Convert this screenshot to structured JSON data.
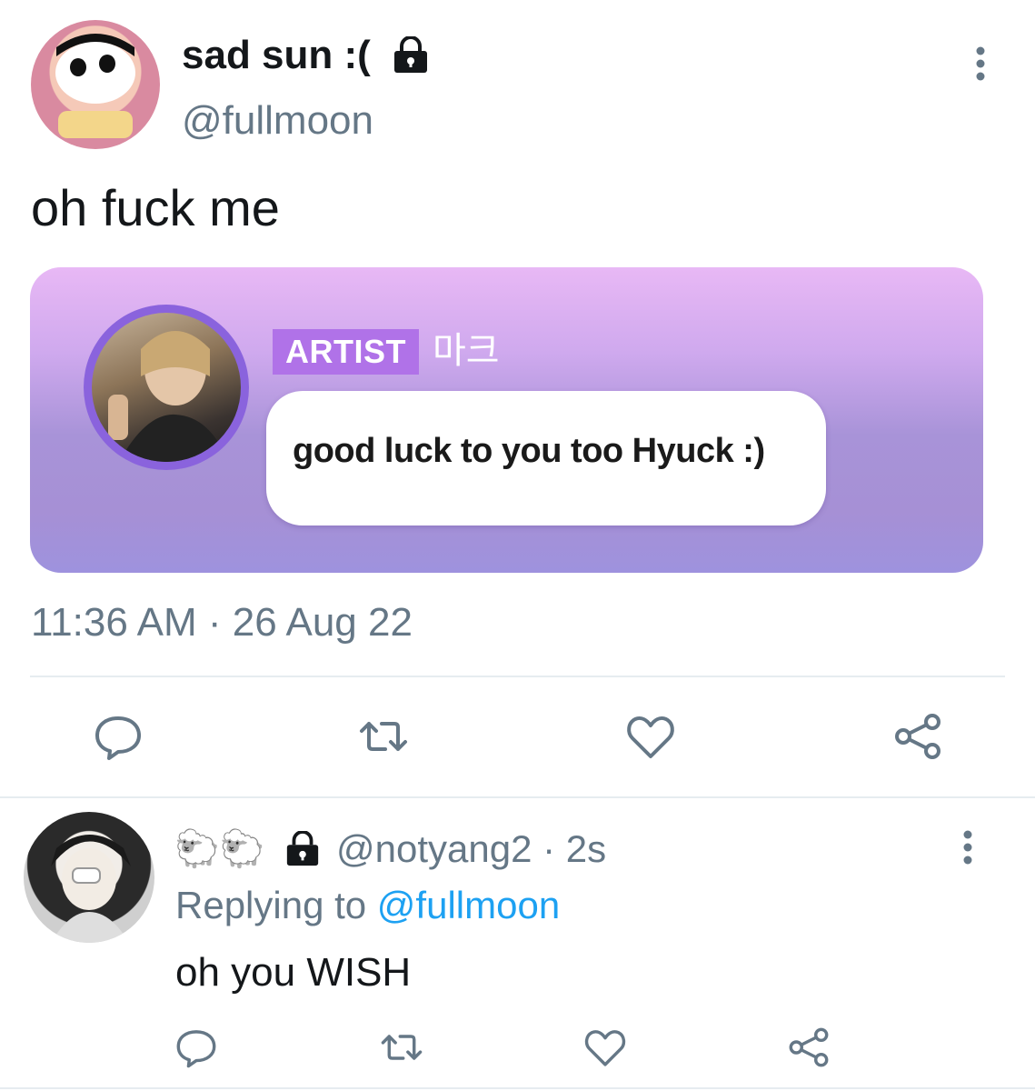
{
  "tweet": {
    "display_name": "sad sun :(",
    "handle": "@fullmoon",
    "text": "oh fuck me",
    "timestamp": "11:36 AM · 26 Aug 22"
  },
  "embedded": {
    "badge": "ARTIST",
    "artist_name": "마크",
    "message": "good luck to you too Hyuck :)"
  },
  "reply": {
    "emoji_name": "🐑🐑",
    "handle_time": "@notyang2 · 2s",
    "replying_prefix": "Replying to ",
    "replying_mention": "@fullmoon",
    "text": "oh you WISH"
  },
  "icons": {
    "lock": "lock-icon",
    "more": "more-vertical-icon",
    "reply": "reply-icon",
    "retweet": "retweet-icon",
    "like": "heart-icon",
    "share": "share-icon"
  },
  "colors": {
    "secondary_text": "#657786",
    "link": "#1da1f2",
    "icon": "#657786",
    "badge": "#b072e8"
  }
}
